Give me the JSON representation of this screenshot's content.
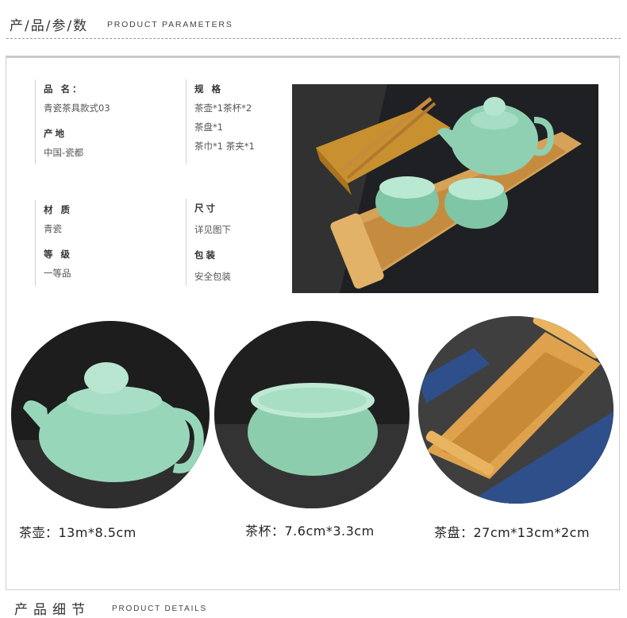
{
  "header": {
    "title_cn": "产/品/参/数",
    "title_en": "PRODUCT PARAMETERS"
  },
  "params": {
    "name_label": "品 名：",
    "name_value": "青瓷茶具款式03",
    "origin_label": "产地",
    "origin_value": "中国-瓷都",
    "spec_label": "规 格",
    "spec_line1": "茶壶*1茶杯*2",
    "spec_line2": "茶盘*1",
    "spec_line3": "茶巾*1  茶夹*1",
    "material_label": "材 质",
    "material_value": "青瓷",
    "grade_label": "等 级",
    "grade_value": "一等品",
    "size_label": "尺寸",
    "size_value": "详见图下",
    "package_label": "包装",
    "package_value": "安全包装"
  },
  "captions": {
    "teapot": "茶壶：13m*8.5cm",
    "cup": "茶杯：7.6cm*3.3cm",
    "tray": "茶盘：27cm*13cm*2cm"
  },
  "footer": {
    "title_cn": "产品细节",
    "title_en": "PRODUCT DETAILS"
  },
  "colors": {
    "celadon": "#8fd1b4",
    "bamboo": "#d9a24e",
    "dark_bg": "#2a2a2a"
  }
}
